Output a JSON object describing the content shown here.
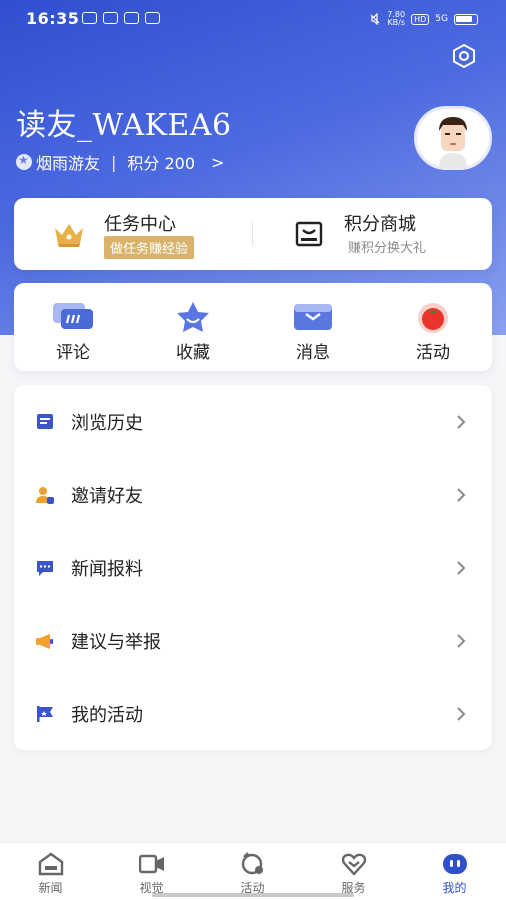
{
  "status_bar": {
    "time": "16:35",
    "net_speed": "7.80",
    "net_unit": "KB/s",
    "hd": "HD",
    "signal": "5G"
  },
  "profile": {
    "username": "读友_WAKEA6",
    "level": "烟雨游友",
    "separator": "|",
    "points": "积分 200",
    "arrow": ">"
  },
  "task_card": {
    "task_center": {
      "title": "任务中心",
      "subtitle": "做任务赚经验"
    },
    "points_mall": {
      "title": "积分商城",
      "subtitle": "赚积分换大礼"
    }
  },
  "quick_actions": [
    {
      "label": "评论",
      "icon": "comment-icon"
    },
    {
      "label": "收藏",
      "icon": "star-icon"
    },
    {
      "label": "消息",
      "icon": "envelope-icon"
    },
    {
      "label": "活动",
      "icon": "tomato-icon"
    }
  ],
  "menu": [
    {
      "label": "浏览历史",
      "icon": "history-icon"
    },
    {
      "label": "邀请好友",
      "icon": "invite-friend-icon"
    },
    {
      "label": "新闻报料",
      "icon": "news-tip-icon"
    },
    {
      "label": "建议与举报",
      "icon": "report-icon"
    },
    {
      "label": "我的活动",
      "icon": "flag-icon"
    }
  ],
  "bottom_nav": [
    {
      "label": "新闻",
      "icon": "home-icon",
      "active": false
    },
    {
      "label": "视觉",
      "icon": "video-icon",
      "active": false
    },
    {
      "label": "活动",
      "icon": "activity-icon",
      "active": false
    },
    {
      "label": "服务",
      "icon": "heart-icon",
      "active": false
    },
    {
      "label": "我的",
      "icon": "profile-icon",
      "active": true
    }
  ],
  "colors": {
    "brand_blue": "#3050c8",
    "gold": "#d9b26b",
    "icon_blue": "#3a55c8",
    "icon_orange": "#f0a030"
  }
}
